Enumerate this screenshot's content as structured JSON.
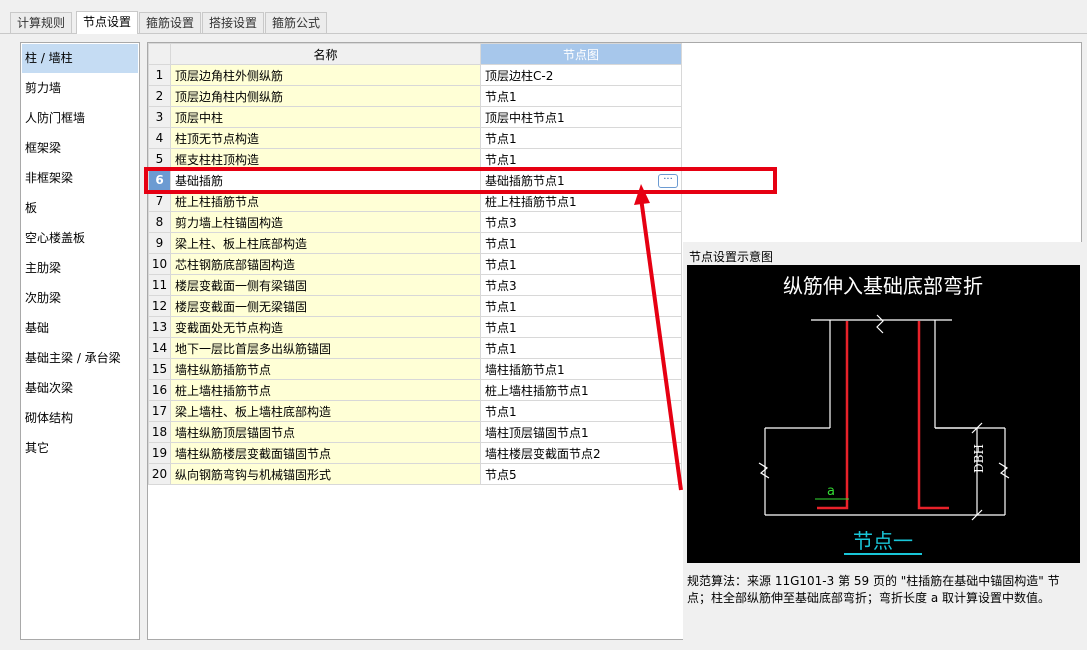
{
  "tabs": [
    "计算规则",
    "节点设置",
    "箍筋设置",
    "搭接设置",
    "箍筋公式"
  ],
  "active_tab": 1,
  "nav_items": [
    "柱 / 墙柱",
    "剪力墙",
    "人防门框墙",
    "框架梁",
    "非框架梁",
    "板",
    "空心楼盖板",
    "主肋梁",
    "次肋梁",
    "基础",
    "基础主梁 / 承台梁",
    "基础次梁",
    "砌体结构",
    "其它"
  ],
  "grid": {
    "col_name": "名称",
    "col_node": "节点图",
    "ellipsis": "···",
    "rows": [
      {
        "num": "1",
        "name": "顶层边角柱外侧纵筋",
        "node": "顶层边柱C-2"
      },
      {
        "num": "2",
        "name": "顶层边角柱内侧纵筋",
        "node": "节点1"
      },
      {
        "num": "3",
        "name": "顶层中柱",
        "node": "顶层中柱节点1"
      },
      {
        "num": "4",
        "name": "柱顶无节点构造",
        "node": "节点1"
      },
      {
        "num": "5",
        "name": "框支柱柱顶构造",
        "node": "节点1"
      },
      {
        "num": "6",
        "name": "基础插筋",
        "node": "基础插筋节点1"
      },
      {
        "num": "7",
        "name": "桩上柱插筋节点",
        "node": "桩上柱插筋节点1"
      },
      {
        "num": "8",
        "name": "剪力墙上柱锚固构造",
        "node": "节点3"
      },
      {
        "num": "9",
        "name": "梁上柱、板上柱底部构造",
        "node": "节点1"
      },
      {
        "num": "10",
        "name": "芯柱钢筋底部锚固构造",
        "node": "节点1"
      },
      {
        "num": "11",
        "name": "楼层变截面一侧有梁锚固",
        "node": "节点3"
      },
      {
        "num": "12",
        "name": "楼层变截面一侧无梁锚固",
        "node": "节点1"
      },
      {
        "num": "13",
        "name": "变截面处无节点构造",
        "node": "节点1"
      },
      {
        "num": "14",
        "name": "地下一层比首层多出纵筋锚固",
        "node": "节点1"
      },
      {
        "num": "15",
        "name": "墙柱纵筋插筋节点",
        "node": "墙柱插筋节点1"
      },
      {
        "num": "16",
        "name": "桩上墙柱插筋节点",
        "node": "桩上墙柱插筋节点1"
      },
      {
        "num": "17",
        "name": "梁上墙柱、板上墙柱底部构造",
        "node": "节点1"
      },
      {
        "num": "18",
        "name": "墙柱纵筋顶层锚固节点",
        "node": "墙柱顶层锚固节点1"
      },
      {
        "num": "19",
        "name": "墙柱纵筋楼层变截面锚固节点",
        "node": "墙柱楼层变截面节点2"
      },
      {
        "num": "20",
        "name": "纵向钢筋弯钩与机械锚固形式",
        "node": "节点5"
      }
    ]
  },
  "diagram": {
    "panel_title": "节点设置示意图",
    "heading": "纵筋伸入基础底部弯折",
    "dim_label": "DBH",
    "a_label": "a",
    "node_label": "节点一",
    "desc": "规范算法：来源 11G101-3 第 59 页的 \"柱插筋在基础中锚固构造\" 节点；柱全部纵筋伸至基础底部弯折；弯折长度 a 取计算设置中数值。"
  },
  "colors": {
    "highlight_red": "#e60012",
    "rebar_red": "#e8222a",
    "label_cyan": "#19c6d8",
    "label_green": "#33dd33"
  }
}
